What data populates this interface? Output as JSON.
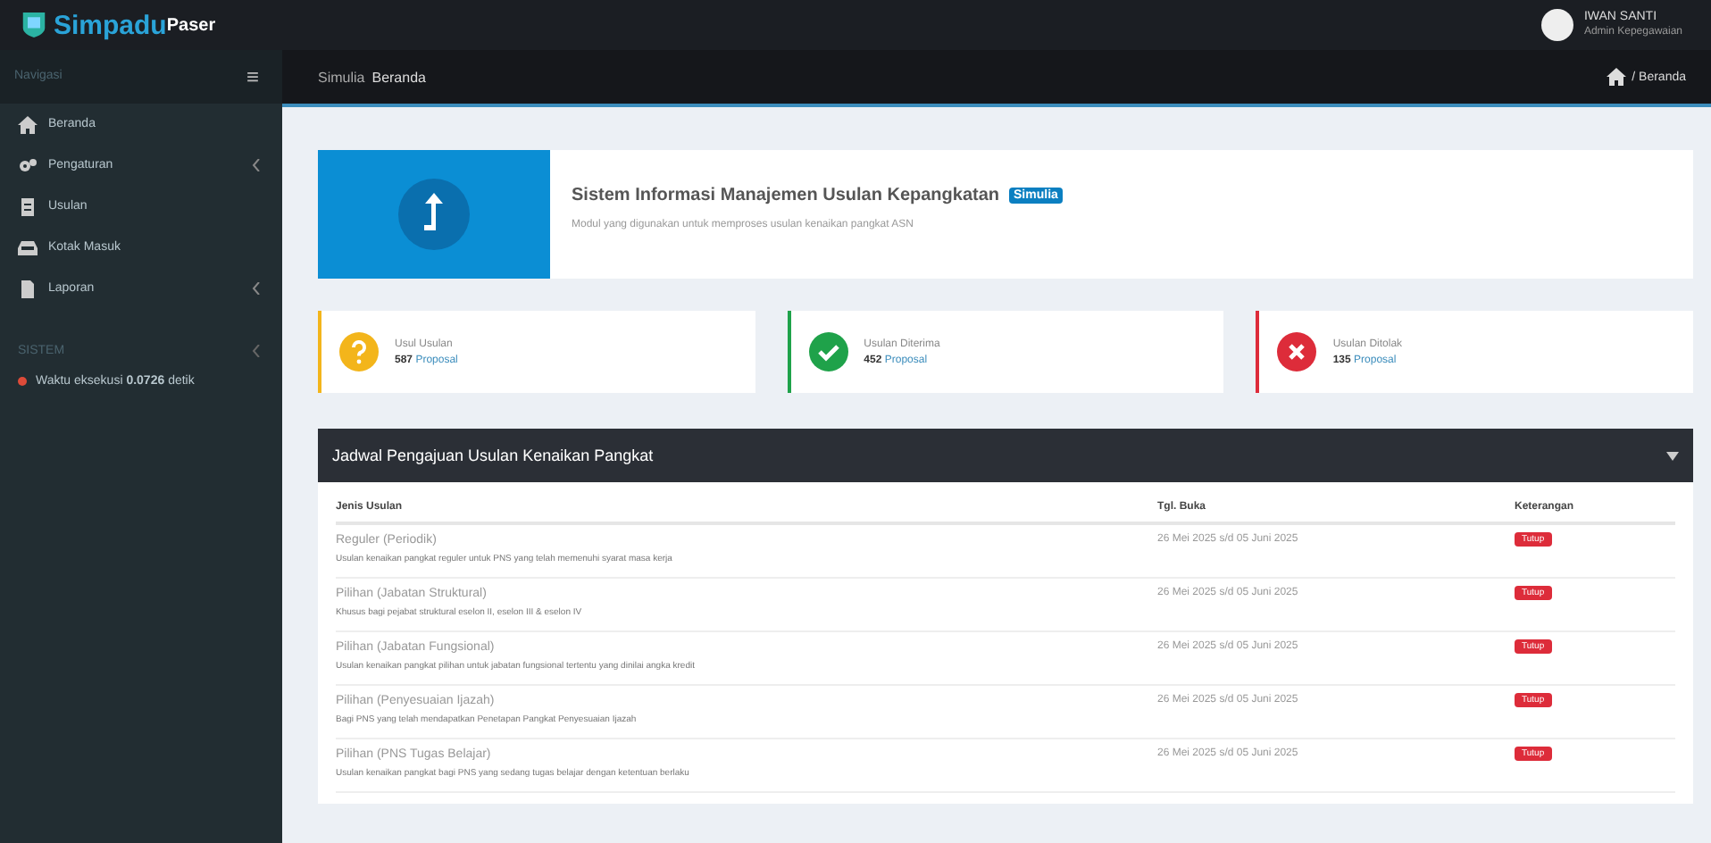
{
  "brand": {
    "main": "Simpadu",
    "accent": "Paser"
  },
  "user": {
    "name": "IWAN SANTI",
    "role": "Admin Kepegawaian"
  },
  "sidebar": {
    "header": "Navigasi",
    "items": [
      {
        "label": "Beranda",
        "kind": "home",
        "has_submenu": false
      },
      {
        "label": "Pengaturan",
        "kind": "settings",
        "has_submenu": true
      },
      {
        "label": "Usulan",
        "kind": "proposals",
        "has_submenu": false
      },
      {
        "label": "Kotak Masuk",
        "kind": "inbox",
        "has_submenu": false
      },
      {
        "label": "Laporan",
        "kind": "reports",
        "has_submenu": true
      }
    ],
    "section": "SISTEM",
    "status": "Waktu eksekusi **0.0726** detik"
  },
  "topbar": {
    "menu_glyph": "≡",
    "title_prefix": "Simulia",
    "title": "Beranda",
    "breadcrumb": "/ Beranda"
  },
  "hero": {
    "title": "Sistem Informasi Manajemen Usulan Kepangkatan",
    "badge": "Simulia",
    "subtitle": "Modul yang digunakan untuk memproses usulan kenaikan pangkat ASN"
  },
  "stats": [
    {
      "kind": "pending",
      "label": "Usul Usulan",
      "count": "587",
      "unit": "Proposal"
    },
    {
      "kind": "accepted",
      "label": "Usulan Diterima",
      "count": "452",
      "unit": "Proposal"
    },
    {
      "kind": "rejected",
      "label": "Usulan Ditolak",
      "count": "135",
      "unit": "Proposal"
    }
  ],
  "table": {
    "title": "Jadwal Pengajuan Usulan Kenaikan Pangkat",
    "columns": [
      "Jenis Usulan",
      "Tgl. Buka",
      "Keterangan"
    ],
    "rows": [
      {
        "name": "Reguler (Periodik)",
        "desc": "Usulan kenaikan pangkat reguler untuk PNS yang telah memenuhi syarat masa kerja",
        "date": "26 Mei 2025 s/d 05 Juni 2025",
        "status": "Tutup"
      },
      {
        "name": "Pilihan (Jabatan Struktural)",
        "desc": "Khusus bagi pejabat struktural eselon II, eselon III & eselon IV",
        "date": "26 Mei 2025 s/d 05 Juni 2025",
        "status": "Tutup"
      },
      {
        "name": "Pilihan (Jabatan Fungsional)",
        "desc": "Usulan kenaikan pangkat pilihan untuk jabatan fungsional tertentu yang dinilai angka kredit",
        "date": "26 Mei 2025 s/d 05 Juni 2025",
        "status": "Tutup"
      },
      {
        "name": "Pilihan (Penyesuaian Ijazah)",
        "desc": "Bagi PNS yang telah mendapatkan Penetapan Pangkat Penyesuaian Ijazah",
        "date": "26 Mei 2025 s/d 05 Juni 2025",
        "status": "Tutup"
      },
      {
        "name": "Pilihan (PNS Tugas Belajar)",
        "desc": "Usulan kenaikan pangkat bagi PNS yang sedang tugas belajar dengan ketentuan berlaku",
        "date": "26 Mei 2025 s/d 05 Juni 2025",
        "status": "Tutup"
      }
    ]
  }
}
